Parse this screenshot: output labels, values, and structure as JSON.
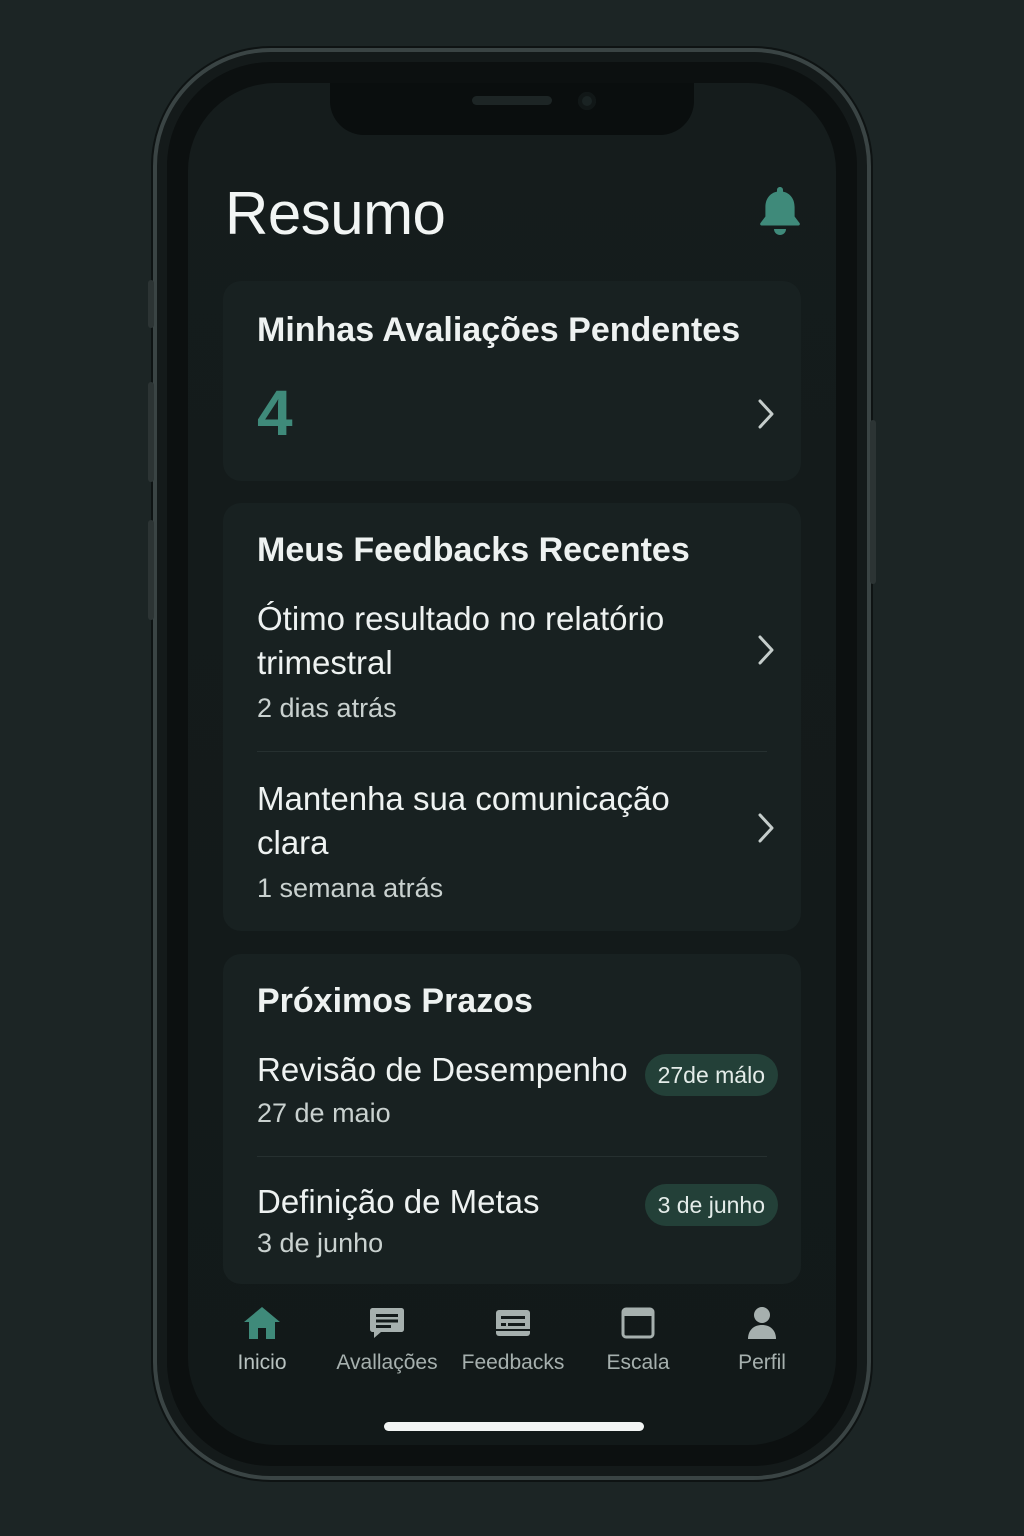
{
  "header": {
    "title": "Resumo"
  },
  "pending": {
    "title": "Minhas Avaliações Pendentes",
    "count": "4"
  },
  "feedbacks": {
    "title": "Meus Feedbacks Recentes",
    "items": [
      {
        "line1": "Ótimo resultado no relatório",
        "line2": "trimestral",
        "time": "2 dias atrás"
      },
      {
        "line1": "Mantenha sua comunicação",
        "line2": "clara",
        "time": "1 semana atrás"
      }
    ]
  },
  "deadlines": {
    "title": "Próximos Prazos",
    "items": [
      {
        "title": "Revisão de Desempenho",
        "date": "27 de maio",
        "badge": "27de málo"
      },
      {
        "title": "Definição de Metas",
        "date": "3 de junho",
        "badge": "3 de junho"
      }
    ]
  },
  "tabs": [
    {
      "label": "Inicio",
      "icon": "home-icon",
      "active": true
    },
    {
      "label": "Avallações",
      "icon": "chat-icon",
      "active": false
    },
    {
      "label": "Feedbacks",
      "icon": "feedback-card-icon",
      "active": false
    },
    {
      "label": "Escala",
      "icon": "window-icon",
      "active": false
    },
    {
      "label": "Perfil",
      "icon": "person-icon",
      "active": false
    }
  ],
  "colors": {
    "accent": "#3f8a7a",
    "badge_bg": "#234038",
    "card_bg": "#182121",
    "page_bg": "#1c2525"
  }
}
